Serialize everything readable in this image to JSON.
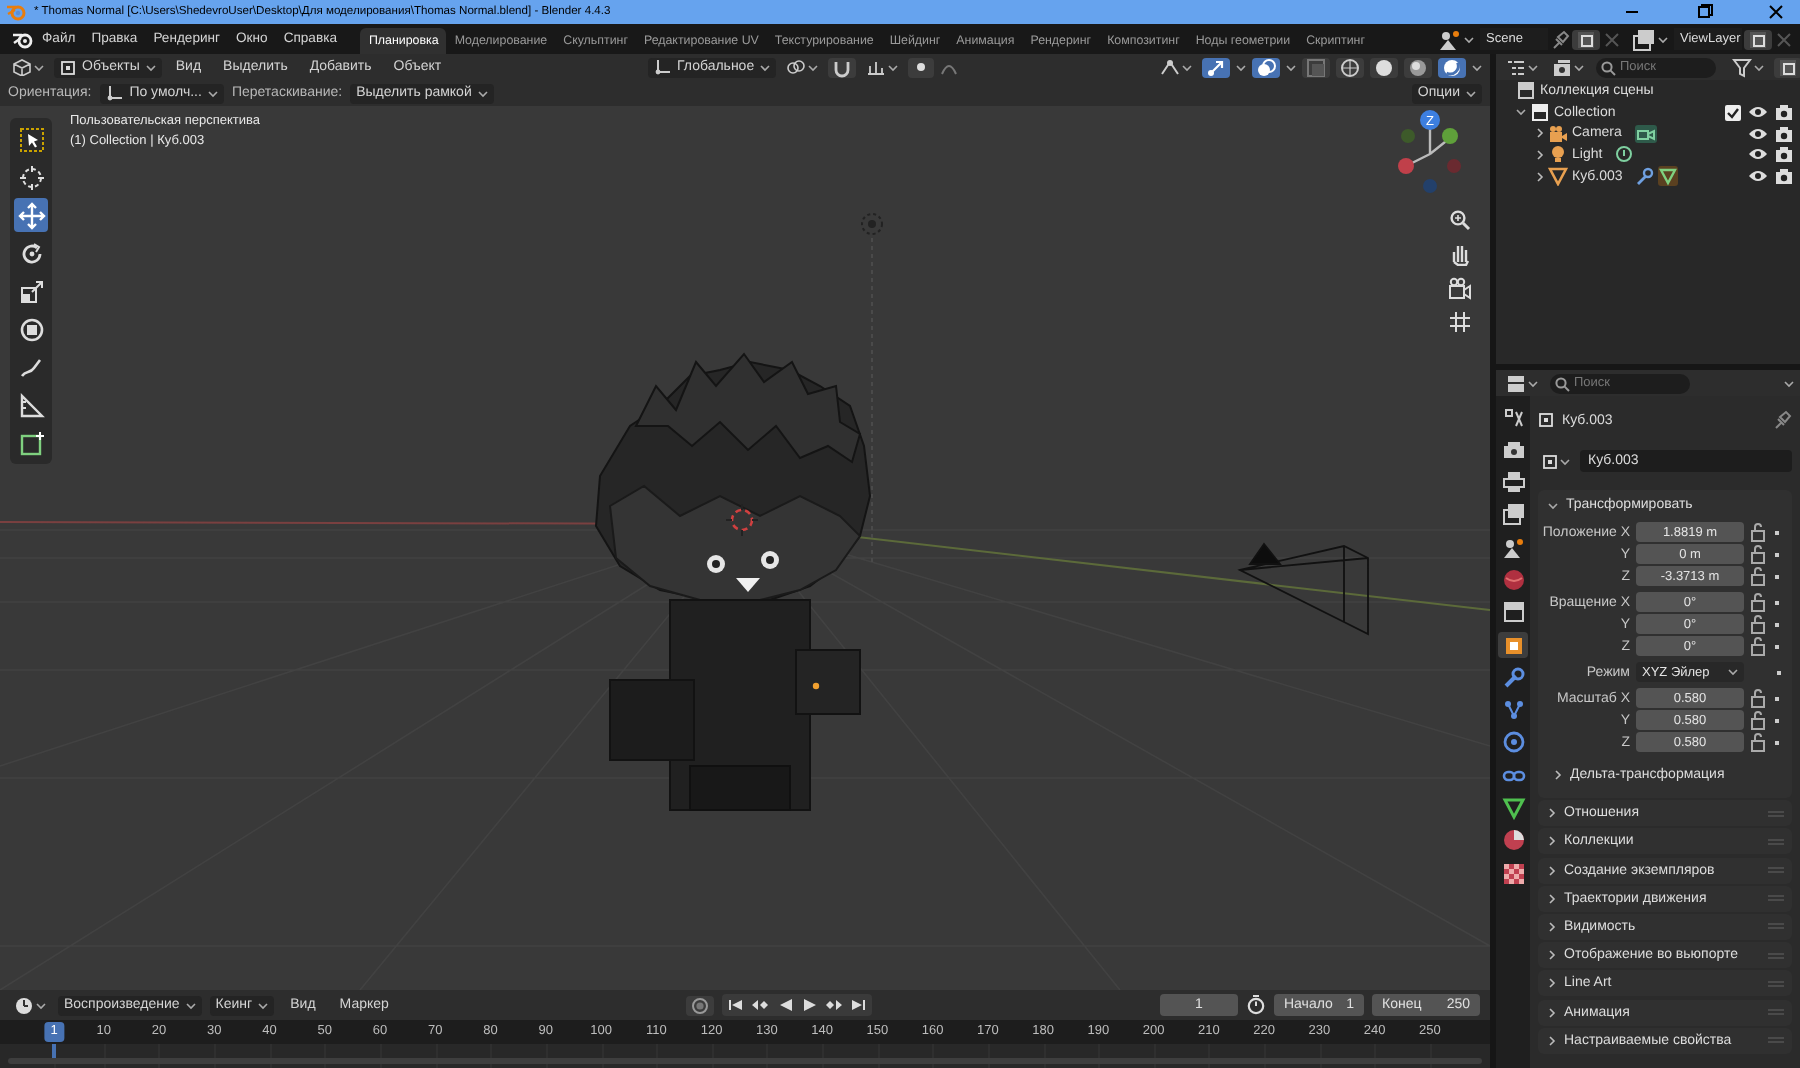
{
  "window": {
    "title": "* Thomas Normal [C:\\Users\\ShedevroUser\\Desktop\\Для моделирования\\Thomas Normal.blend] - Blender 4.4.3"
  },
  "menu": [
    "Файл",
    "Правка",
    "Рендеринг",
    "Окно",
    "Справка"
  ],
  "workspaces": [
    {
      "label": "Планировка",
      "selected": true
    },
    {
      "label": "Моделирование",
      "selected": false
    },
    {
      "label": "Скульптинг",
      "selected": false
    },
    {
      "label": "Редактирование UV",
      "selected": false
    },
    {
      "label": "Текстурирование",
      "selected": false
    },
    {
      "label": "Шейдинг",
      "selected": false
    },
    {
      "label": "Анимация",
      "selected": false
    },
    {
      "label": "Рендеринг",
      "selected": false
    },
    {
      "label": "Композитинг",
      "selected": false
    },
    {
      "label": "Ноды геометрии",
      "selected": false
    },
    {
      "label": "Скриптинг",
      "selected": false
    }
  ],
  "scene": "Scene",
  "view_layer": "ViewLayer",
  "viewport": {
    "mode": "Объекты",
    "menus": [
      "Вид",
      "Выделить",
      "Добавить",
      "Объект"
    ],
    "transform_orientation": "Глобальное",
    "display": [
      {
        "kind": "gizmos",
        "on": true
      },
      {
        "kind": "overlays",
        "on": true
      },
      {
        "kind": "xray",
        "on": false
      }
    ],
    "shading": [
      {
        "kind": "wireframe",
        "selected": false
      },
      {
        "kind": "solid",
        "selected": false
      },
      {
        "kind": "material",
        "selected": false
      },
      {
        "kind": "rendered",
        "selected": true
      }
    ],
    "orientation_label": "Ориентация:",
    "orientation": "По умолч...",
    "drag_label": "Перетаскивание:",
    "drag": "Выделить рамкой",
    "options": "Опции",
    "view_name": "Пользовательская перспектива",
    "context": "(1) Collection | Куб.003",
    "gizmo_axis": "Z",
    "tools": [
      {
        "kind": "select",
        "selected": false
      },
      {
        "kind": "cursor",
        "selected": false
      },
      {
        "kind": "move",
        "selected": true
      },
      {
        "kind": "rotate",
        "selected": false
      },
      {
        "kind": "scale",
        "selected": false
      },
      {
        "kind": "transform",
        "selected": false
      },
      {
        "kind": "annotate",
        "selected": false
      },
      {
        "kind": "measure",
        "selected": false
      },
      {
        "kind": "add_cube",
        "selected": false
      }
    ]
  },
  "outliner": {
    "search": {
      "placeholder": "Поиск"
    },
    "root": "Коллекция сцены",
    "items": [
      {
        "name": "Collection",
        "kind": "collection",
        "expanded": true,
        "checked": true,
        "children": [
          {
            "name": "Camera",
            "kind": "camera",
            "expanded": false
          },
          {
            "name": "Light",
            "kind": "light",
            "expanded": false
          },
          {
            "name": "Куб.003",
            "kind": "mesh",
            "expanded": false
          }
        ]
      }
    ]
  },
  "properties": {
    "search": {
      "placeholder": "Поиск"
    },
    "tabs": [
      {
        "kind": "tool",
        "selected": false
      },
      {
        "kind": "render",
        "selected": false
      },
      {
        "kind": "output",
        "selected": false
      },
      {
        "kind": "view_layer",
        "selected": false
      },
      {
        "kind": "scene",
        "selected": false
      },
      {
        "kind": "world",
        "selected": false
      },
      {
        "kind": "collection",
        "selected": false
      },
      {
        "kind": "object",
        "selected": true
      },
      {
        "kind": "modifiers",
        "selected": false
      },
      {
        "kind": "particles",
        "selected": false
      },
      {
        "kind": "physics",
        "selected": false
      },
      {
        "kind": "constraints",
        "selected": false
      },
      {
        "kind": "data",
        "selected": false
      },
      {
        "kind": "material",
        "selected": false
      },
      {
        "kind": "texture",
        "selected": false
      }
    ],
    "object": "Куб.003",
    "object_name": "Куб.003",
    "transform": {
      "title": "Трансформировать",
      "expanded": true,
      "rows": [
        {
          "label": "Положение X",
          "value": "1.8819 m",
          "kind": "number",
          "group_start": false
        },
        {
          "label": "Y",
          "value": "0 m",
          "kind": "number",
          "group_start": false
        },
        {
          "label": "Z",
          "value": "-3.3713 m",
          "kind": "number",
          "group_start": false
        },
        {
          "label": "Вращение X",
          "value": "0°",
          "kind": "number",
          "group_start": true
        },
        {
          "label": "Y",
          "value": "0°",
          "kind": "number",
          "group_start": false
        },
        {
          "label": "Z",
          "value": "0°",
          "kind": "number",
          "group_start": false
        },
        {
          "label": "Режим",
          "value": "XYZ Эйлер",
          "kind": "dropdown",
          "group_start": true
        },
        {
          "label": "Масштаб X",
          "value": "0.580",
          "kind": "number",
          "group_start": true
        },
        {
          "label": "Y",
          "value": "0.580",
          "kind": "number",
          "group_start": false
        },
        {
          "label": "Z",
          "value": "0.580",
          "kind": "number",
          "group_start": false
        }
      ]
    },
    "subpanel": {
      "title": "Дельта-трансформация",
      "expanded": false
    },
    "panels": [
      {
        "title": "Отношения",
        "expanded": false
      },
      {
        "title": "Коллекции",
        "expanded": false
      },
      {
        "title": "Создание экземпляров",
        "expanded": false
      },
      {
        "title": "Траектории движения",
        "expanded": false
      },
      {
        "title": "Видимость",
        "expanded": false
      },
      {
        "title": "Отображение во вьюпорте",
        "expanded": false
      },
      {
        "title": "Line Art",
        "expanded": false
      },
      {
        "title": "Анимация",
        "expanded": false
      },
      {
        "title": "Настраиваемые свойства",
        "expanded": false
      }
    ]
  },
  "timeline": {
    "menus": [
      {
        "label": "Воспроизведение",
        "dropdown": true
      },
      {
        "label": "Кеинг",
        "dropdown": true
      },
      {
        "label": "Вид",
        "dropdown": false
      },
      {
        "label": "Маркер",
        "dropdown": false
      }
    ],
    "current_frame": "1",
    "start_label": "Начало",
    "start": "1",
    "end_label": "Конец",
    "end": "250",
    "ruler": [
      {
        "label": "1",
        "selected": true
      },
      {
        "label": "10",
        "selected": false
      },
      {
        "label": "20",
        "selected": false
      },
      {
        "label": "30",
        "selected": false
      },
      {
        "label": "40",
        "selected": false
      },
      {
        "label": "50",
        "selected": false
      },
      {
        "label": "60",
        "selected": false
      },
      {
        "label": "70",
        "selected": false
      },
      {
        "label": "80",
        "selected": false
      },
      {
        "label": "90",
        "selected": false
      },
      {
        "label": "100",
        "selected": false
      },
      {
        "label": "110",
        "selected": false
      },
      {
        "label": "120",
        "selected": false
      },
      {
        "label": "130",
        "selected": false
      },
      {
        "label": "140",
        "selected": false
      },
      {
        "label": "150",
        "selected": false
      },
      {
        "label": "160",
        "selected": false
      },
      {
        "label": "170",
        "selected": false
      },
      {
        "label": "180",
        "selected": false
      },
      {
        "label": "190",
        "selected": false
      },
      {
        "label": "200",
        "selected": false
      },
      {
        "label": "210",
        "selected": false
      },
      {
        "label": "220",
        "selected": false
      },
      {
        "label": "230",
        "selected": false
      },
      {
        "label": "240",
        "selected": false
      },
      {
        "label": "250",
        "selected": false
      }
    ]
  }
}
